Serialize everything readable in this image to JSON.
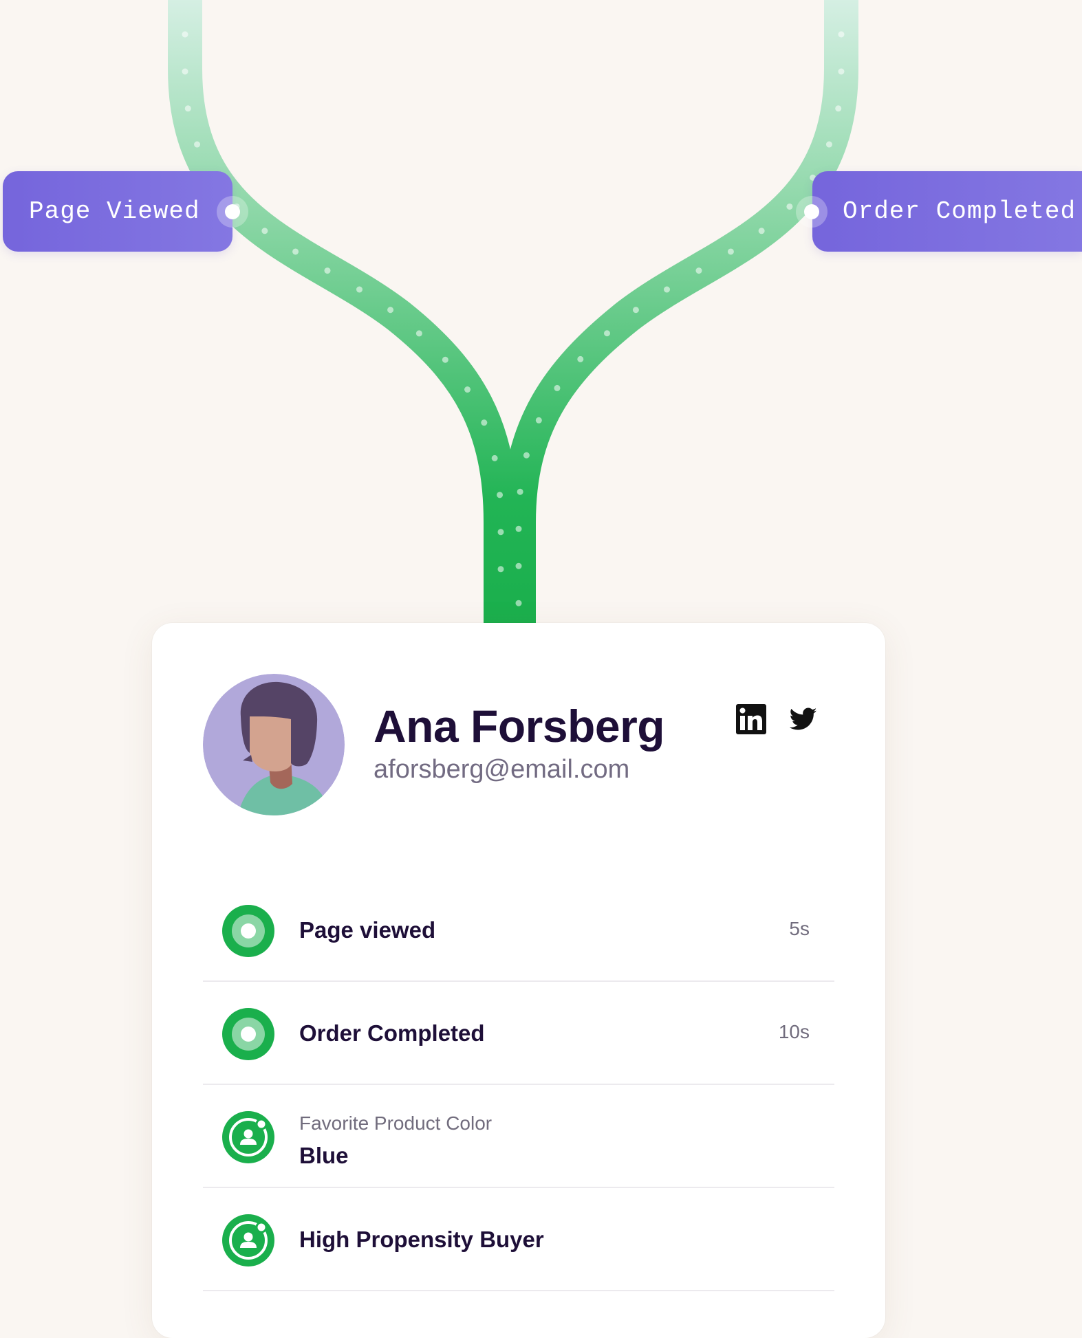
{
  "flow": {
    "left_event": "Page Viewed",
    "right_event": "Order Completed"
  },
  "profile": {
    "name": "Ana Forsberg",
    "email": "aforsberg@email.com",
    "social": [
      "linkedin-icon",
      "twitter-icon"
    ]
  },
  "timeline": [
    {
      "title": "Page viewed",
      "time": "5s",
      "icon": "event-dot-icon"
    },
    {
      "title": "Order Completed",
      "time": "10s",
      "icon": "event-dot-icon"
    },
    {
      "label": "Favorite Product Color",
      "title": "Blue",
      "icon": "user-trait-icon"
    },
    {
      "title": "High Propensity Buyer",
      "icon": "user-trait-icon"
    }
  ],
  "colors": {
    "background": "#faf6f2",
    "accent_green": "#1aaf4c",
    "pill_purple": "#7565dc",
    "text_dark": "#1e0f38",
    "text_muted": "#716c7d"
  }
}
